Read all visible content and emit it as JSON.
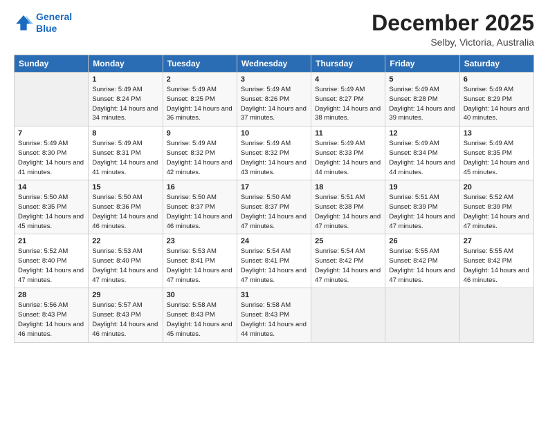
{
  "header": {
    "logo_line1": "General",
    "logo_line2": "Blue",
    "month": "December 2025",
    "location": "Selby, Victoria, Australia"
  },
  "weekdays": [
    "Sunday",
    "Monday",
    "Tuesday",
    "Wednesday",
    "Thursday",
    "Friday",
    "Saturday"
  ],
  "weeks": [
    [
      {
        "day": "",
        "sunrise": "",
        "sunset": "",
        "daylight": ""
      },
      {
        "day": "1",
        "sunrise": "Sunrise: 5:49 AM",
        "sunset": "Sunset: 8:24 PM",
        "daylight": "Daylight: 14 hours and 34 minutes."
      },
      {
        "day": "2",
        "sunrise": "Sunrise: 5:49 AM",
        "sunset": "Sunset: 8:25 PM",
        "daylight": "Daylight: 14 hours and 36 minutes."
      },
      {
        "day": "3",
        "sunrise": "Sunrise: 5:49 AM",
        "sunset": "Sunset: 8:26 PM",
        "daylight": "Daylight: 14 hours and 37 minutes."
      },
      {
        "day": "4",
        "sunrise": "Sunrise: 5:49 AM",
        "sunset": "Sunset: 8:27 PM",
        "daylight": "Daylight: 14 hours and 38 minutes."
      },
      {
        "day": "5",
        "sunrise": "Sunrise: 5:49 AM",
        "sunset": "Sunset: 8:28 PM",
        "daylight": "Daylight: 14 hours and 39 minutes."
      },
      {
        "day": "6",
        "sunrise": "Sunrise: 5:49 AM",
        "sunset": "Sunset: 8:29 PM",
        "daylight": "Daylight: 14 hours and 40 minutes."
      }
    ],
    [
      {
        "day": "7",
        "sunrise": "Sunrise: 5:49 AM",
        "sunset": "Sunset: 8:30 PM",
        "daylight": "Daylight: 14 hours and 41 minutes."
      },
      {
        "day": "8",
        "sunrise": "Sunrise: 5:49 AM",
        "sunset": "Sunset: 8:31 PM",
        "daylight": "Daylight: 14 hours and 41 minutes."
      },
      {
        "day": "9",
        "sunrise": "Sunrise: 5:49 AM",
        "sunset": "Sunset: 8:32 PM",
        "daylight": "Daylight: 14 hours and 42 minutes."
      },
      {
        "day": "10",
        "sunrise": "Sunrise: 5:49 AM",
        "sunset": "Sunset: 8:32 PM",
        "daylight": "Daylight: 14 hours and 43 minutes."
      },
      {
        "day": "11",
        "sunrise": "Sunrise: 5:49 AM",
        "sunset": "Sunset: 8:33 PM",
        "daylight": "Daylight: 14 hours and 44 minutes."
      },
      {
        "day": "12",
        "sunrise": "Sunrise: 5:49 AM",
        "sunset": "Sunset: 8:34 PM",
        "daylight": "Daylight: 14 hours and 44 minutes."
      },
      {
        "day": "13",
        "sunrise": "Sunrise: 5:49 AM",
        "sunset": "Sunset: 8:35 PM",
        "daylight": "Daylight: 14 hours and 45 minutes."
      }
    ],
    [
      {
        "day": "14",
        "sunrise": "Sunrise: 5:50 AM",
        "sunset": "Sunset: 8:35 PM",
        "daylight": "Daylight: 14 hours and 45 minutes."
      },
      {
        "day": "15",
        "sunrise": "Sunrise: 5:50 AM",
        "sunset": "Sunset: 8:36 PM",
        "daylight": "Daylight: 14 hours and 46 minutes."
      },
      {
        "day": "16",
        "sunrise": "Sunrise: 5:50 AM",
        "sunset": "Sunset: 8:37 PM",
        "daylight": "Daylight: 14 hours and 46 minutes."
      },
      {
        "day": "17",
        "sunrise": "Sunrise: 5:50 AM",
        "sunset": "Sunset: 8:37 PM",
        "daylight": "Daylight: 14 hours and 47 minutes."
      },
      {
        "day": "18",
        "sunrise": "Sunrise: 5:51 AM",
        "sunset": "Sunset: 8:38 PM",
        "daylight": "Daylight: 14 hours and 47 minutes."
      },
      {
        "day": "19",
        "sunrise": "Sunrise: 5:51 AM",
        "sunset": "Sunset: 8:39 PM",
        "daylight": "Daylight: 14 hours and 47 minutes."
      },
      {
        "day": "20",
        "sunrise": "Sunrise: 5:52 AM",
        "sunset": "Sunset: 8:39 PM",
        "daylight": "Daylight: 14 hours and 47 minutes."
      }
    ],
    [
      {
        "day": "21",
        "sunrise": "Sunrise: 5:52 AM",
        "sunset": "Sunset: 8:40 PM",
        "daylight": "Daylight: 14 hours and 47 minutes."
      },
      {
        "day": "22",
        "sunrise": "Sunrise: 5:53 AM",
        "sunset": "Sunset: 8:40 PM",
        "daylight": "Daylight: 14 hours and 47 minutes."
      },
      {
        "day": "23",
        "sunrise": "Sunrise: 5:53 AM",
        "sunset": "Sunset: 8:41 PM",
        "daylight": "Daylight: 14 hours and 47 minutes."
      },
      {
        "day": "24",
        "sunrise": "Sunrise: 5:54 AM",
        "sunset": "Sunset: 8:41 PM",
        "daylight": "Daylight: 14 hours and 47 minutes."
      },
      {
        "day": "25",
        "sunrise": "Sunrise: 5:54 AM",
        "sunset": "Sunset: 8:42 PM",
        "daylight": "Daylight: 14 hours and 47 minutes."
      },
      {
        "day": "26",
        "sunrise": "Sunrise: 5:55 AM",
        "sunset": "Sunset: 8:42 PM",
        "daylight": "Daylight: 14 hours and 47 minutes."
      },
      {
        "day": "27",
        "sunrise": "Sunrise: 5:55 AM",
        "sunset": "Sunset: 8:42 PM",
        "daylight": "Daylight: 14 hours and 46 minutes."
      }
    ],
    [
      {
        "day": "28",
        "sunrise": "Sunrise: 5:56 AM",
        "sunset": "Sunset: 8:43 PM",
        "daylight": "Daylight: 14 hours and 46 minutes."
      },
      {
        "day": "29",
        "sunrise": "Sunrise: 5:57 AM",
        "sunset": "Sunset: 8:43 PM",
        "daylight": "Daylight: 14 hours and 46 minutes."
      },
      {
        "day": "30",
        "sunrise": "Sunrise: 5:58 AM",
        "sunset": "Sunset: 8:43 PM",
        "daylight": "Daylight: 14 hours and 45 minutes."
      },
      {
        "day": "31",
        "sunrise": "Sunrise: 5:58 AM",
        "sunset": "Sunset: 8:43 PM",
        "daylight": "Daylight: 14 hours and 44 minutes."
      },
      {
        "day": "",
        "sunrise": "",
        "sunset": "",
        "daylight": ""
      },
      {
        "day": "",
        "sunrise": "",
        "sunset": "",
        "daylight": ""
      },
      {
        "day": "",
        "sunrise": "",
        "sunset": "",
        "daylight": ""
      }
    ]
  ]
}
